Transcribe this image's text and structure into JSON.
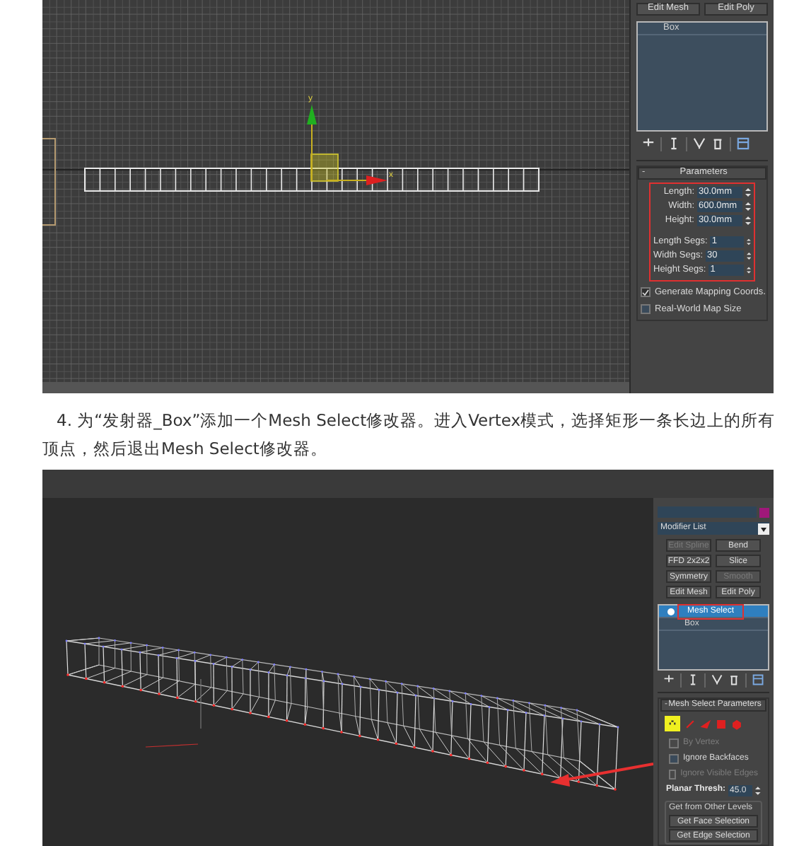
{
  "screenshot_1": {
    "viewport": {
      "axis_labels": [
        "y",
        "x"
      ]
    },
    "modifier_buttons": [
      {
        "label": "Edit Mesh",
        "disabled": false
      },
      {
        "label": "Edit Poly",
        "disabled": false
      }
    ],
    "stack": [
      {
        "label": "Box",
        "selected": false,
        "highlight": false
      }
    ],
    "rollout": {
      "toggle": "-",
      "title": "Parameters",
      "highlight": true,
      "field_groups": [
        [
          {
            "label": "Length:",
            "value": "30.0mm"
          },
          {
            "label": "Width:",
            "value": "600.0mm"
          },
          {
            "label": "Height:",
            "value": "30.0mm"
          }
        ],
        [
          {
            "label": "Length Segs:",
            "value": "1"
          },
          {
            "label": "Width Segs:",
            "value": "30"
          },
          {
            "label": "Height Segs:",
            "value": "1"
          }
        ]
      ],
      "checkboxes": [
        {
          "label": "Generate Mapping Coords.",
          "checked": true,
          "disabled": false
        },
        {
          "label": "Real-World Map Size",
          "checked": false,
          "disabled": false
        }
      ]
    }
  },
  "instruction": "4. 为“发射器_Box”添加一个Mesh Select修改器。进入Vertex模式，选择矩形一条长边上的所有顶点，然后退出Mesh Select修改器。",
  "screenshot_2": {
    "modifier_list": "Modifier List",
    "modifier_buttons": [
      {
        "label": "Edit Spline",
        "disabled": true
      },
      {
        "label": "Bend",
        "disabled": false
      },
      {
        "label": "FFD 2x2x2",
        "disabled": false
      },
      {
        "label": "Slice",
        "disabled": false
      },
      {
        "label": "Symmetry",
        "disabled": false
      },
      {
        "label": "Smooth",
        "disabled": true
      },
      {
        "label": "Edit Mesh",
        "disabled": false
      },
      {
        "label": "Edit Poly",
        "disabled": false
      }
    ],
    "stack": [
      {
        "label": "Mesh Select",
        "selected": true,
        "highlight": true
      },
      {
        "label": "Box",
        "selected": false,
        "highlight": false
      }
    ],
    "rollout": {
      "toggle": "-",
      "title": "Mesh Select Parameters",
      "levels": [
        {
          "kind": "vertex",
          "selected": true
        },
        {
          "kind": "edge",
          "selected": false
        },
        {
          "kind": "border",
          "selected": false
        },
        {
          "kind": "polygon",
          "selected": false
        },
        {
          "kind": "element",
          "selected": false
        }
      ],
      "checkboxes": [
        {
          "label": "By Vertex",
          "checked": false,
          "disabled": true
        },
        {
          "label": "Ignore Backfaces",
          "checked": false,
          "disabled": false
        },
        {
          "label": "Ignore Visible Edges",
          "checked": false,
          "disabled": true
        }
      ],
      "planar_thresh": {
        "label": "Planar Thresh:",
        "value": "45.0"
      },
      "group_title": "Get from Other Levels",
      "buttons": [
        "Get Face Selection",
        "Get Edge Selection"
      ]
    }
  }
}
